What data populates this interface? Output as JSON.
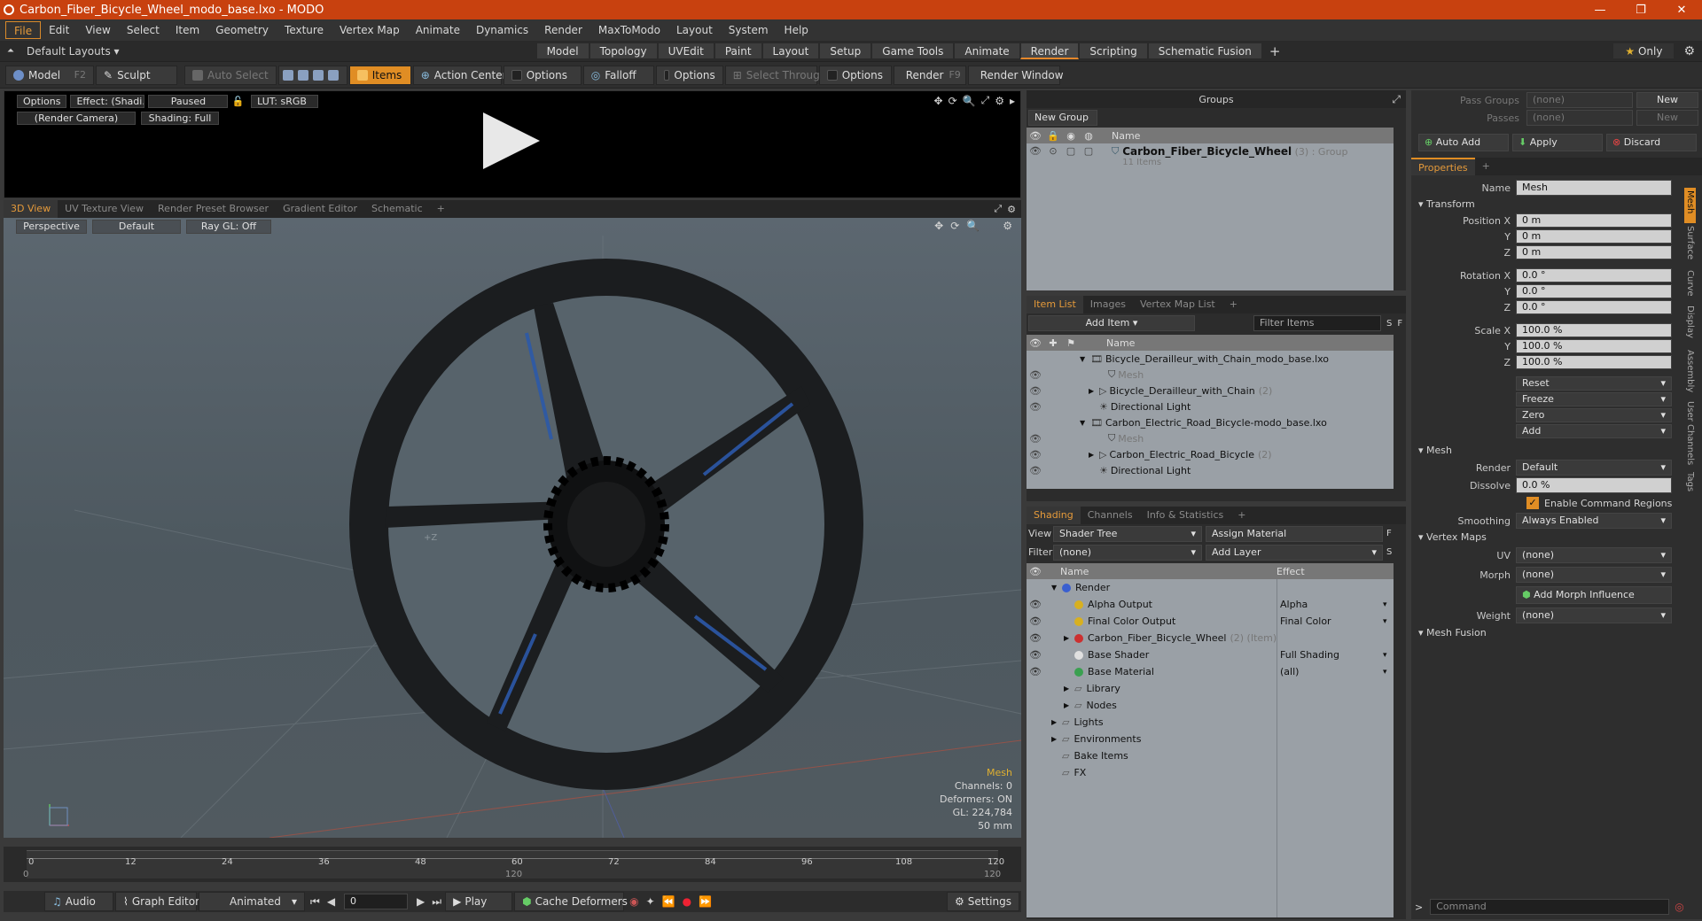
{
  "title": "Carbon_Fiber_Bicycle_Wheel_modo_base.lxo - MODO",
  "menu": [
    "File",
    "Edit",
    "View",
    "Select",
    "Item",
    "Geometry",
    "Texture",
    "Vertex Map",
    "Animate",
    "Dynamics",
    "Render",
    "MaxToModo",
    "Layout",
    "System",
    "Help"
  ],
  "layouts": {
    "label": "Default Layouts",
    "tabs": [
      "Model",
      "Topology",
      "UVEdit",
      "Paint",
      "Layout",
      "Setup",
      "Game Tools",
      "Animate",
      "Render",
      "Scripting",
      "Schematic Fusion"
    ],
    "only": "Only"
  },
  "toolbar": {
    "model": "Model",
    "model_key": "F2",
    "sculpt": "Sculpt",
    "auto_select": "Auto Select",
    "items": "Items",
    "action_center": "Action Center",
    "options1": "Options",
    "falloff": "Falloff",
    "options2": "Options",
    "select_through": "Select Through",
    "options3": "Options",
    "render": "Render",
    "render_key": "F9",
    "render_window": "Render Window"
  },
  "preview": {
    "options": "Options",
    "effect": "Effect: (Shadi...",
    "paused": "Paused",
    "lut": "LUT: sRGB",
    "camera": "(Render Camera)",
    "shading": "Shading: Full"
  },
  "viewtabs": [
    "3D View",
    "UV Texture View",
    "Render Preset Browser",
    "Gradient Editor",
    "Schematic"
  ],
  "viewport": {
    "perspective": "Perspective",
    "default": "Default",
    "raygl": "Ray GL: Off",
    "axis": "+Z",
    "info": {
      "mesh": "Mesh",
      "channels": "Channels: 0",
      "deformers": "Deformers: ON",
      "gl": "GL: 224,784",
      "mm": "50 mm"
    }
  },
  "timeline": {
    "ticks_top": [
      "0",
      "12",
      "24",
      "36",
      "48",
      "60",
      "72",
      "84",
      "96",
      "108",
      "120"
    ],
    "bottom_left": "0",
    "bottom_mid": "120",
    "bottom_right": "120"
  },
  "transport": {
    "audio": "Audio",
    "graph_editor": "Graph Editor",
    "animated": "Animated",
    "frame": "0",
    "play": "Play",
    "cache_deformers": "Cache Deformers",
    "settings": "Settings"
  },
  "groups": {
    "title": "Groups",
    "new_group": "New Group",
    "name_col": "Name",
    "item_name": "Carbon_Fiber_Bicycle_Wheel",
    "item_count": "(3)",
    "item_type": ": Group",
    "item_sub": "11 Items"
  },
  "itemlist": {
    "tabs": [
      "Item List",
      "Images",
      "Vertex Map List"
    ],
    "add_item": "Add Item",
    "filter": "Filter Items",
    "name_col": "Name",
    "rows": [
      {
        "text": "Bicycle_Derailleur_with_Chain_modo_base.lxo",
        "indent": 0,
        "arrow": "▼",
        "icon": "scene",
        "dim": false,
        "count": ""
      },
      {
        "text": "Mesh",
        "indent": 2,
        "arrow": "",
        "icon": "mesh",
        "dim": true,
        "count": ""
      },
      {
        "text": "Bicycle_Derailleur_with_Chain",
        "indent": 1,
        "arrow": "▶",
        "icon": "group",
        "dim": false,
        "count": "(2)"
      },
      {
        "text": "Directional Light",
        "indent": 1,
        "arrow": "",
        "icon": "light",
        "dim": false,
        "count": ""
      },
      {
        "text": "Carbon_Electric_Road_Bicycle-modo_base.lxo",
        "indent": 0,
        "arrow": "▼",
        "icon": "scene",
        "dim": false,
        "count": ""
      },
      {
        "text": "Mesh",
        "indent": 2,
        "arrow": "",
        "icon": "mesh",
        "dim": true,
        "count": ""
      },
      {
        "text": "Carbon_Electric_Road_Bicycle",
        "indent": 1,
        "arrow": "▶",
        "icon": "group",
        "dim": false,
        "count": "(2)"
      },
      {
        "text": "Directional Light",
        "indent": 1,
        "arrow": "",
        "icon": "light",
        "dim": false,
        "count": ""
      }
    ]
  },
  "shading": {
    "tabs": [
      "Shading",
      "Channels",
      "Info & Statistics"
    ],
    "view_label": "View",
    "view_value": "Shader Tree",
    "assign": "Assign Material",
    "filter_label": "Filter",
    "filter_value": "(none)",
    "add_layer": "Add Layer",
    "name_col": "Name",
    "effect_col": "Effect",
    "rows": [
      {
        "text": "Render",
        "effect": "",
        "indent": 0,
        "color": "#3a5fd0",
        "eye": false,
        "arrow": "▼",
        "extra": ""
      },
      {
        "text": "Alpha Output",
        "effect": "Alpha",
        "indent": 1,
        "color": "#d8b020",
        "eye": true,
        "arrow": "",
        "extra": ""
      },
      {
        "text": "Final Color Output",
        "effect": "Final Color",
        "indent": 1,
        "color": "#d8b020",
        "eye": true,
        "arrow": "",
        "extra": ""
      },
      {
        "text": "Carbon_Fiber_Bicycle_Wheel",
        "effect": "",
        "indent": 1,
        "color": "#cc3030",
        "eye": true,
        "arrow": "▶",
        "extra": "(2) (Item)"
      },
      {
        "text": "Base Shader",
        "effect": "Full Shading",
        "indent": 1,
        "color": "#e0e0e0",
        "eye": true,
        "arrow": "",
        "extra": ""
      },
      {
        "text": "Base Material",
        "effect": "(all)",
        "indent": 1,
        "color": "#3aa050",
        "eye": true,
        "arrow": "",
        "extra": ""
      },
      {
        "text": "Library",
        "effect": "",
        "indent": 1,
        "color": "",
        "eye": false,
        "arrow": "▶",
        "extra": ""
      },
      {
        "text": "Nodes",
        "effect": "",
        "indent": 1,
        "color": "",
        "eye": false,
        "arrow": "▶",
        "extra": ""
      },
      {
        "text": "Lights",
        "effect": "",
        "indent": 0,
        "color": "",
        "eye": false,
        "arrow": "▶",
        "extra": ""
      },
      {
        "text": "Environments",
        "effect": "",
        "indent": 0,
        "color": "",
        "eye": false,
        "arrow": "▶",
        "extra": ""
      },
      {
        "text": "Bake Items",
        "effect": "",
        "indent": 0,
        "color": "",
        "eye": false,
        "arrow": "",
        "extra": ""
      },
      {
        "text": "FX",
        "effect": "",
        "indent": 0,
        "color": "",
        "eye": false,
        "arrow": "",
        "extra": ""
      }
    ]
  },
  "props": {
    "pass_groups": "Pass Groups",
    "passes": "Passes",
    "none": "(none)",
    "new": "New",
    "auto_add": "Auto Add",
    "apply": "Apply",
    "discard": "Discard",
    "properties_tab": "Properties",
    "name_label": "Name",
    "name_value": "Mesh",
    "transform": "Transform",
    "pos_x": "Position X",
    "y": "Y",
    "z": "Z",
    "rot_x": "Rotation X",
    "scale_x": "Scale X",
    "zero_m": "0 m",
    "zero_deg": "0.0 °",
    "hundred": "100.0 %",
    "reset": "Reset",
    "freeze": "Freeze",
    "zero": "Zero",
    "add": "Add",
    "mesh": "Mesh",
    "render_label": "Render",
    "render_value": "Default",
    "dissolve_label": "Dissolve",
    "dissolve_value": "0.0 %",
    "enable_cmd": "Enable Command Regions",
    "smoothing_label": "Smoothing",
    "smoothing_value": "Always Enabled",
    "vertex_maps": "Vertex Maps",
    "uv_label": "UV",
    "morph_label": "Morph",
    "add_morph": "Add Morph Influence",
    "weight_label": "Weight",
    "mesh_fusion": "Mesh Fusion",
    "side_tabs": [
      "Mesh",
      "Surface",
      "Curve",
      "Display",
      "Assembly",
      "User Channels",
      "Tags"
    ],
    "command": "Command"
  }
}
